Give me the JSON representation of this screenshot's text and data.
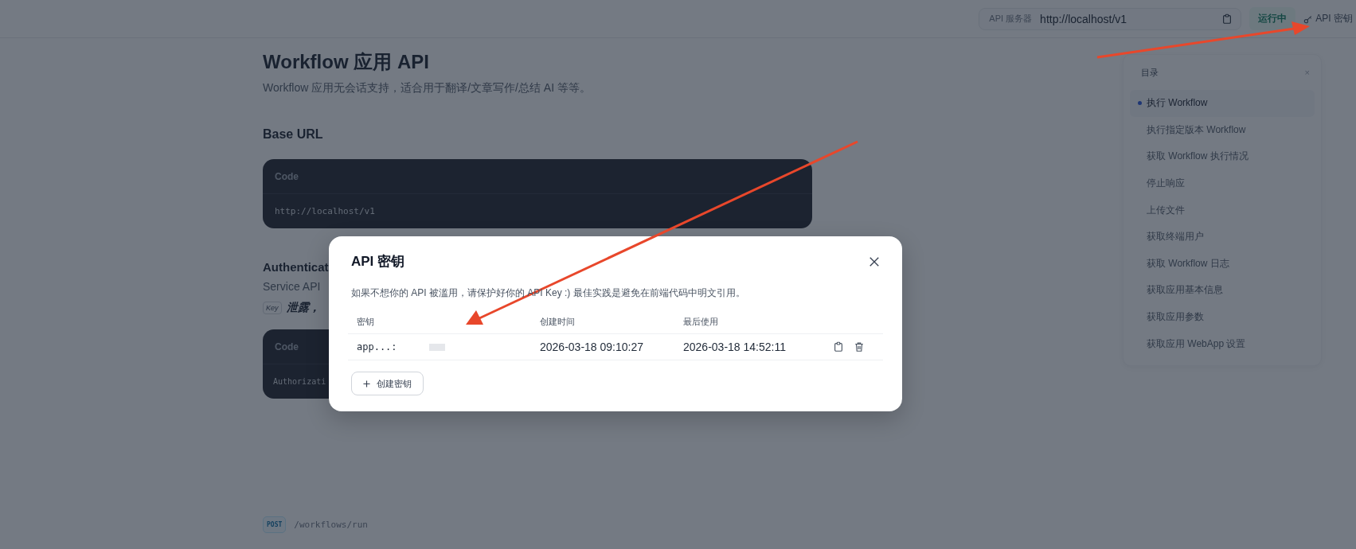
{
  "top_bar": {
    "server_label": "API 服务器",
    "server_url": "http://localhost/v1",
    "status": "运行中",
    "api_key_link": "API 密钥"
  },
  "doc": {
    "title": "Workflow 应用 API",
    "subtitle": "Workflow 应用无会话支持，适合用于翻译/文章写作/总结 AI 等等。",
    "base_url": {
      "heading": "Base URL",
      "code_label": "Code",
      "code": "http://localhost/v1"
    },
    "auth": {
      "heading": "Authenticat",
      "text": "Service API",
      "key_badge": "Key",
      "warning": "泄露，",
      "code_label": "Code",
      "code": "Authorizati"
    },
    "endpoint": {
      "method": "POST",
      "path": "/workflows/run"
    }
  },
  "toc": {
    "title": "目录",
    "close": "×",
    "items": [
      {
        "label": "执行 Workflow",
        "selected": true
      },
      {
        "label": "执行指定版本 Workflow",
        "selected": false
      },
      {
        "label": "获取 Workflow 执行情况",
        "selected": false
      },
      {
        "label": "停止响应",
        "selected": false
      },
      {
        "label": "上传文件",
        "selected": false
      },
      {
        "label": "获取终端用户",
        "selected": false
      },
      {
        "label": "获取 Workflow 日志",
        "selected": false
      },
      {
        "label": "获取应用基本信息",
        "selected": false
      },
      {
        "label": "获取应用参数",
        "selected": false
      },
      {
        "label": "获取应用 WebApp 设置",
        "selected": false
      }
    ]
  },
  "dialog": {
    "title": "API 密钥",
    "description": "如果不想你的 API 被滥用，请保护好你的 API Key :) 最佳实践是避免在前端代码中明文引用。",
    "table": {
      "columns": [
        "密钥",
        "创建时间",
        "最后使用"
      ],
      "rows": [
        {
          "key": "app...:",
          "created": "2026-03-18 09:10:27",
          "last_used": "2026-03-18 14:52:11"
        }
      ]
    },
    "create_button": "创建密钥"
  }
}
